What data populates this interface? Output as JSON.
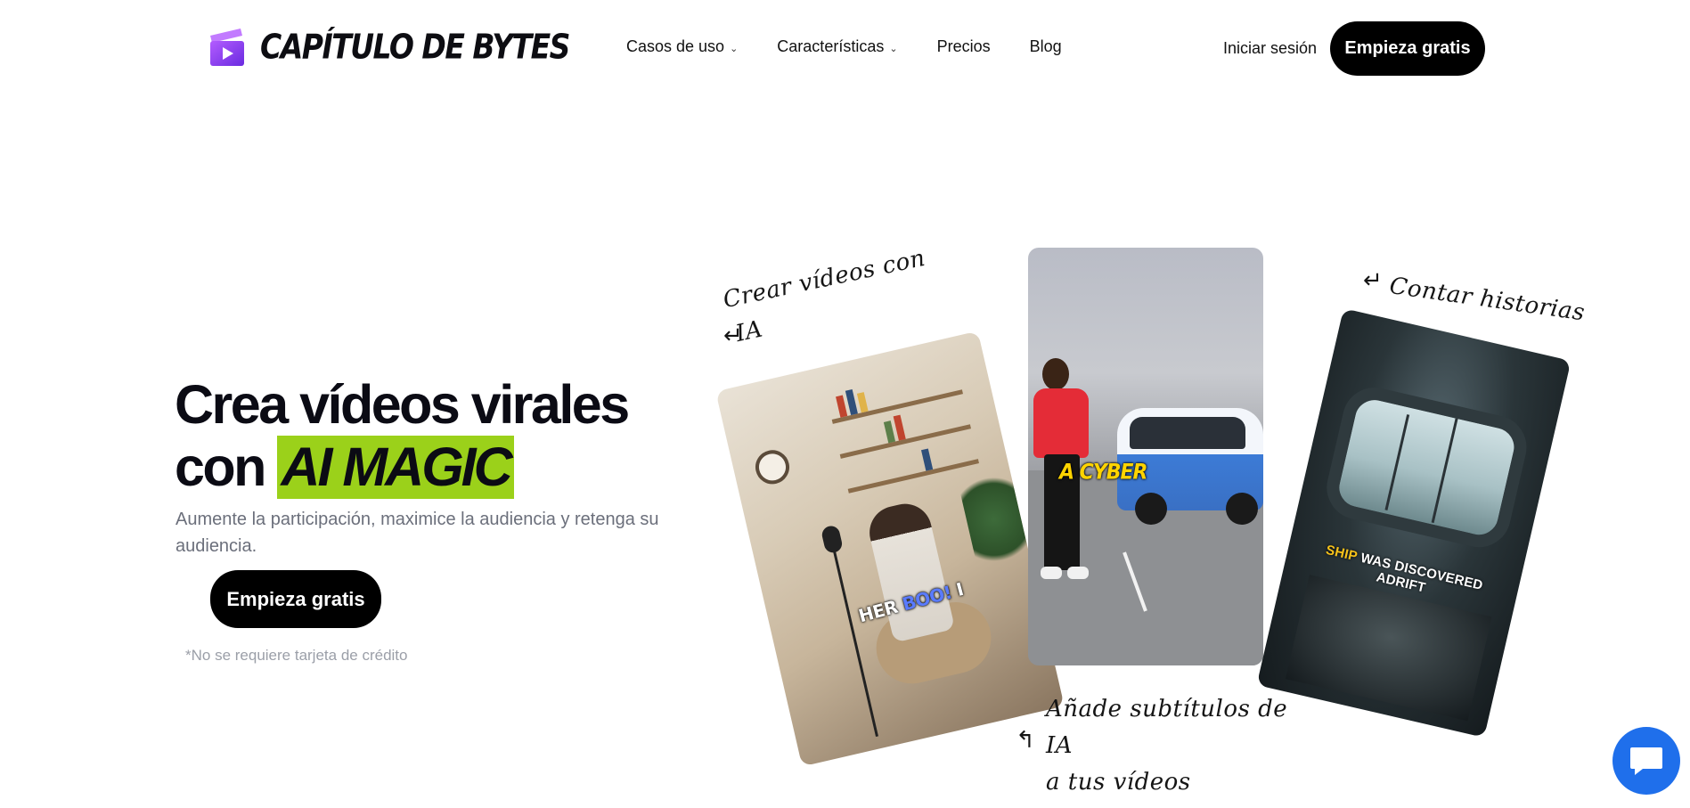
{
  "header": {
    "brand_name": "CAPÍTULO DE BYTES",
    "nav": [
      {
        "label": "Casos de uso",
        "has_dropdown": true
      },
      {
        "label": "Características",
        "has_dropdown": true
      },
      {
        "label": "Precios",
        "has_dropdown": false
      },
      {
        "label": "Blog",
        "has_dropdown": false
      }
    ],
    "login_label": "Iniciar sesión",
    "cta_label": "Empieza gratis"
  },
  "hero": {
    "title_line1": "Crea vídeos virales",
    "title_line2_prefix": "con",
    "title_highlight": "AI MAGIC",
    "subtitle": "Aumente la participación, maximice la audiencia y retenga su audiencia.",
    "cta_label": "Empieza gratis",
    "note": "*No se requiere tarjeta de crédito"
  },
  "annotations": {
    "card1_line1": "Crear vídeos con",
    "card1_line2": "IA",
    "card3": "Contar historias",
    "card2_line1": "Añade subtítulos de",
    "card2_line2": "IA",
    "card2_line3": "a tus vídeos"
  },
  "cards": {
    "card1_caption_a": "HER",
    "card1_caption_b": "BOO!",
    "card1_caption_c": "I",
    "card2_caption": "A CYBER",
    "card3_caption_ship": "SHIP",
    "card3_caption_rest": "WAS DISCOVERED",
    "card3_caption_line2": "ADRIFT"
  },
  "colors": {
    "highlight": "#9bd11a",
    "dark_button": "#000000",
    "chat_button": "#1f6feb",
    "brand_purple": "#8b3dff"
  },
  "icons": {
    "logo": "play-clapper-icon",
    "dropdown": "chevron-down-icon",
    "chat": "chat-bubble-icon"
  }
}
